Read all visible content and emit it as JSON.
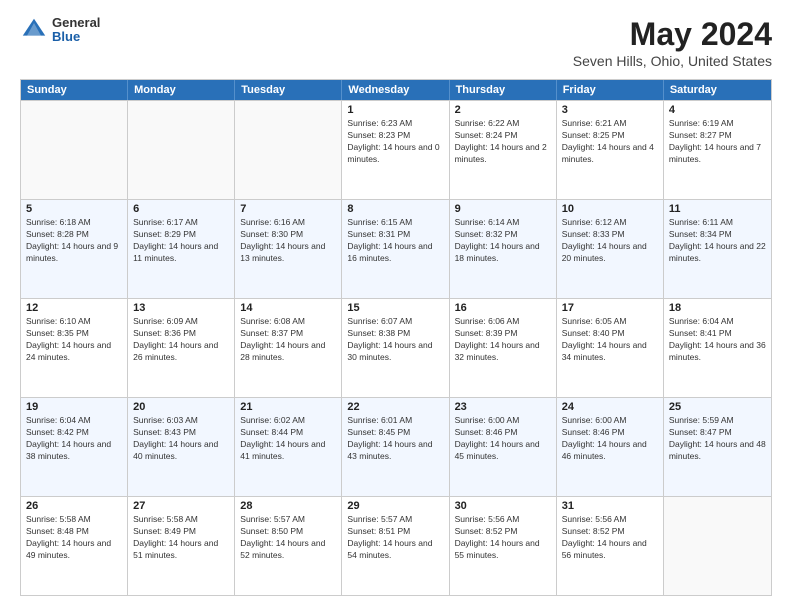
{
  "header": {
    "logo": {
      "line1": "General",
      "line2": "Blue"
    },
    "title": "May 2024",
    "subtitle": "Seven Hills, Ohio, United States"
  },
  "days_of_week": [
    "Sunday",
    "Monday",
    "Tuesday",
    "Wednesday",
    "Thursday",
    "Friday",
    "Saturday"
  ],
  "rows": [
    [
      {
        "day": "",
        "empty": true
      },
      {
        "day": "",
        "empty": true
      },
      {
        "day": "",
        "empty": true
      },
      {
        "day": "1",
        "sunrise": "6:23 AM",
        "sunset": "8:23 PM",
        "daylight": "14 hours and 0 minutes."
      },
      {
        "day": "2",
        "sunrise": "6:22 AM",
        "sunset": "8:24 PM",
        "daylight": "14 hours and 2 minutes."
      },
      {
        "day": "3",
        "sunrise": "6:21 AM",
        "sunset": "8:25 PM",
        "daylight": "14 hours and 4 minutes."
      },
      {
        "day": "4",
        "sunrise": "6:19 AM",
        "sunset": "8:27 PM",
        "daylight": "14 hours and 7 minutes."
      }
    ],
    [
      {
        "day": "5",
        "sunrise": "6:18 AM",
        "sunset": "8:28 PM",
        "daylight": "14 hours and 9 minutes."
      },
      {
        "day": "6",
        "sunrise": "6:17 AM",
        "sunset": "8:29 PM",
        "daylight": "14 hours and 11 minutes."
      },
      {
        "day": "7",
        "sunrise": "6:16 AM",
        "sunset": "8:30 PM",
        "daylight": "14 hours and 13 minutes."
      },
      {
        "day": "8",
        "sunrise": "6:15 AM",
        "sunset": "8:31 PM",
        "daylight": "14 hours and 16 minutes."
      },
      {
        "day": "9",
        "sunrise": "6:14 AM",
        "sunset": "8:32 PM",
        "daylight": "14 hours and 18 minutes."
      },
      {
        "day": "10",
        "sunrise": "6:12 AM",
        "sunset": "8:33 PM",
        "daylight": "14 hours and 20 minutes."
      },
      {
        "day": "11",
        "sunrise": "6:11 AM",
        "sunset": "8:34 PM",
        "daylight": "14 hours and 22 minutes."
      }
    ],
    [
      {
        "day": "12",
        "sunrise": "6:10 AM",
        "sunset": "8:35 PM",
        "daylight": "14 hours and 24 minutes."
      },
      {
        "day": "13",
        "sunrise": "6:09 AM",
        "sunset": "8:36 PM",
        "daylight": "14 hours and 26 minutes."
      },
      {
        "day": "14",
        "sunrise": "6:08 AM",
        "sunset": "8:37 PM",
        "daylight": "14 hours and 28 minutes."
      },
      {
        "day": "15",
        "sunrise": "6:07 AM",
        "sunset": "8:38 PM",
        "daylight": "14 hours and 30 minutes."
      },
      {
        "day": "16",
        "sunrise": "6:06 AM",
        "sunset": "8:39 PM",
        "daylight": "14 hours and 32 minutes."
      },
      {
        "day": "17",
        "sunrise": "6:05 AM",
        "sunset": "8:40 PM",
        "daylight": "14 hours and 34 minutes."
      },
      {
        "day": "18",
        "sunrise": "6:04 AM",
        "sunset": "8:41 PM",
        "daylight": "14 hours and 36 minutes."
      }
    ],
    [
      {
        "day": "19",
        "sunrise": "6:04 AM",
        "sunset": "8:42 PM",
        "daylight": "14 hours and 38 minutes."
      },
      {
        "day": "20",
        "sunrise": "6:03 AM",
        "sunset": "8:43 PM",
        "daylight": "14 hours and 40 minutes."
      },
      {
        "day": "21",
        "sunrise": "6:02 AM",
        "sunset": "8:44 PM",
        "daylight": "14 hours and 41 minutes."
      },
      {
        "day": "22",
        "sunrise": "6:01 AM",
        "sunset": "8:45 PM",
        "daylight": "14 hours and 43 minutes."
      },
      {
        "day": "23",
        "sunrise": "6:00 AM",
        "sunset": "8:46 PM",
        "daylight": "14 hours and 45 minutes."
      },
      {
        "day": "24",
        "sunrise": "6:00 AM",
        "sunset": "8:46 PM",
        "daylight": "14 hours and 46 minutes."
      },
      {
        "day": "25",
        "sunrise": "5:59 AM",
        "sunset": "8:47 PM",
        "daylight": "14 hours and 48 minutes."
      }
    ],
    [
      {
        "day": "26",
        "sunrise": "5:58 AM",
        "sunset": "8:48 PM",
        "daylight": "14 hours and 49 minutes."
      },
      {
        "day": "27",
        "sunrise": "5:58 AM",
        "sunset": "8:49 PM",
        "daylight": "14 hours and 51 minutes."
      },
      {
        "day": "28",
        "sunrise": "5:57 AM",
        "sunset": "8:50 PM",
        "daylight": "14 hours and 52 minutes."
      },
      {
        "day": "29",
        "sunrise": "5:57 AM",
        "sunset": "8:51 PM",
        "daylight": "14 hours and 54 minutes."
      },
      {
        "day": "30",
        "sunrise": "5:56 AM",
        "sunset": "8:52 PM",
        "daylight": "14 hours and 55 minutes."
      },
      {
        "day": "31",
        "sunrise": "5:56 AM",
        "sunset": "8:52 PM",
        "daylight": "14 hours and 56 minutes."
      },
      {
        "day": "",
        "empty": true
      }
    ]
  ]
}
